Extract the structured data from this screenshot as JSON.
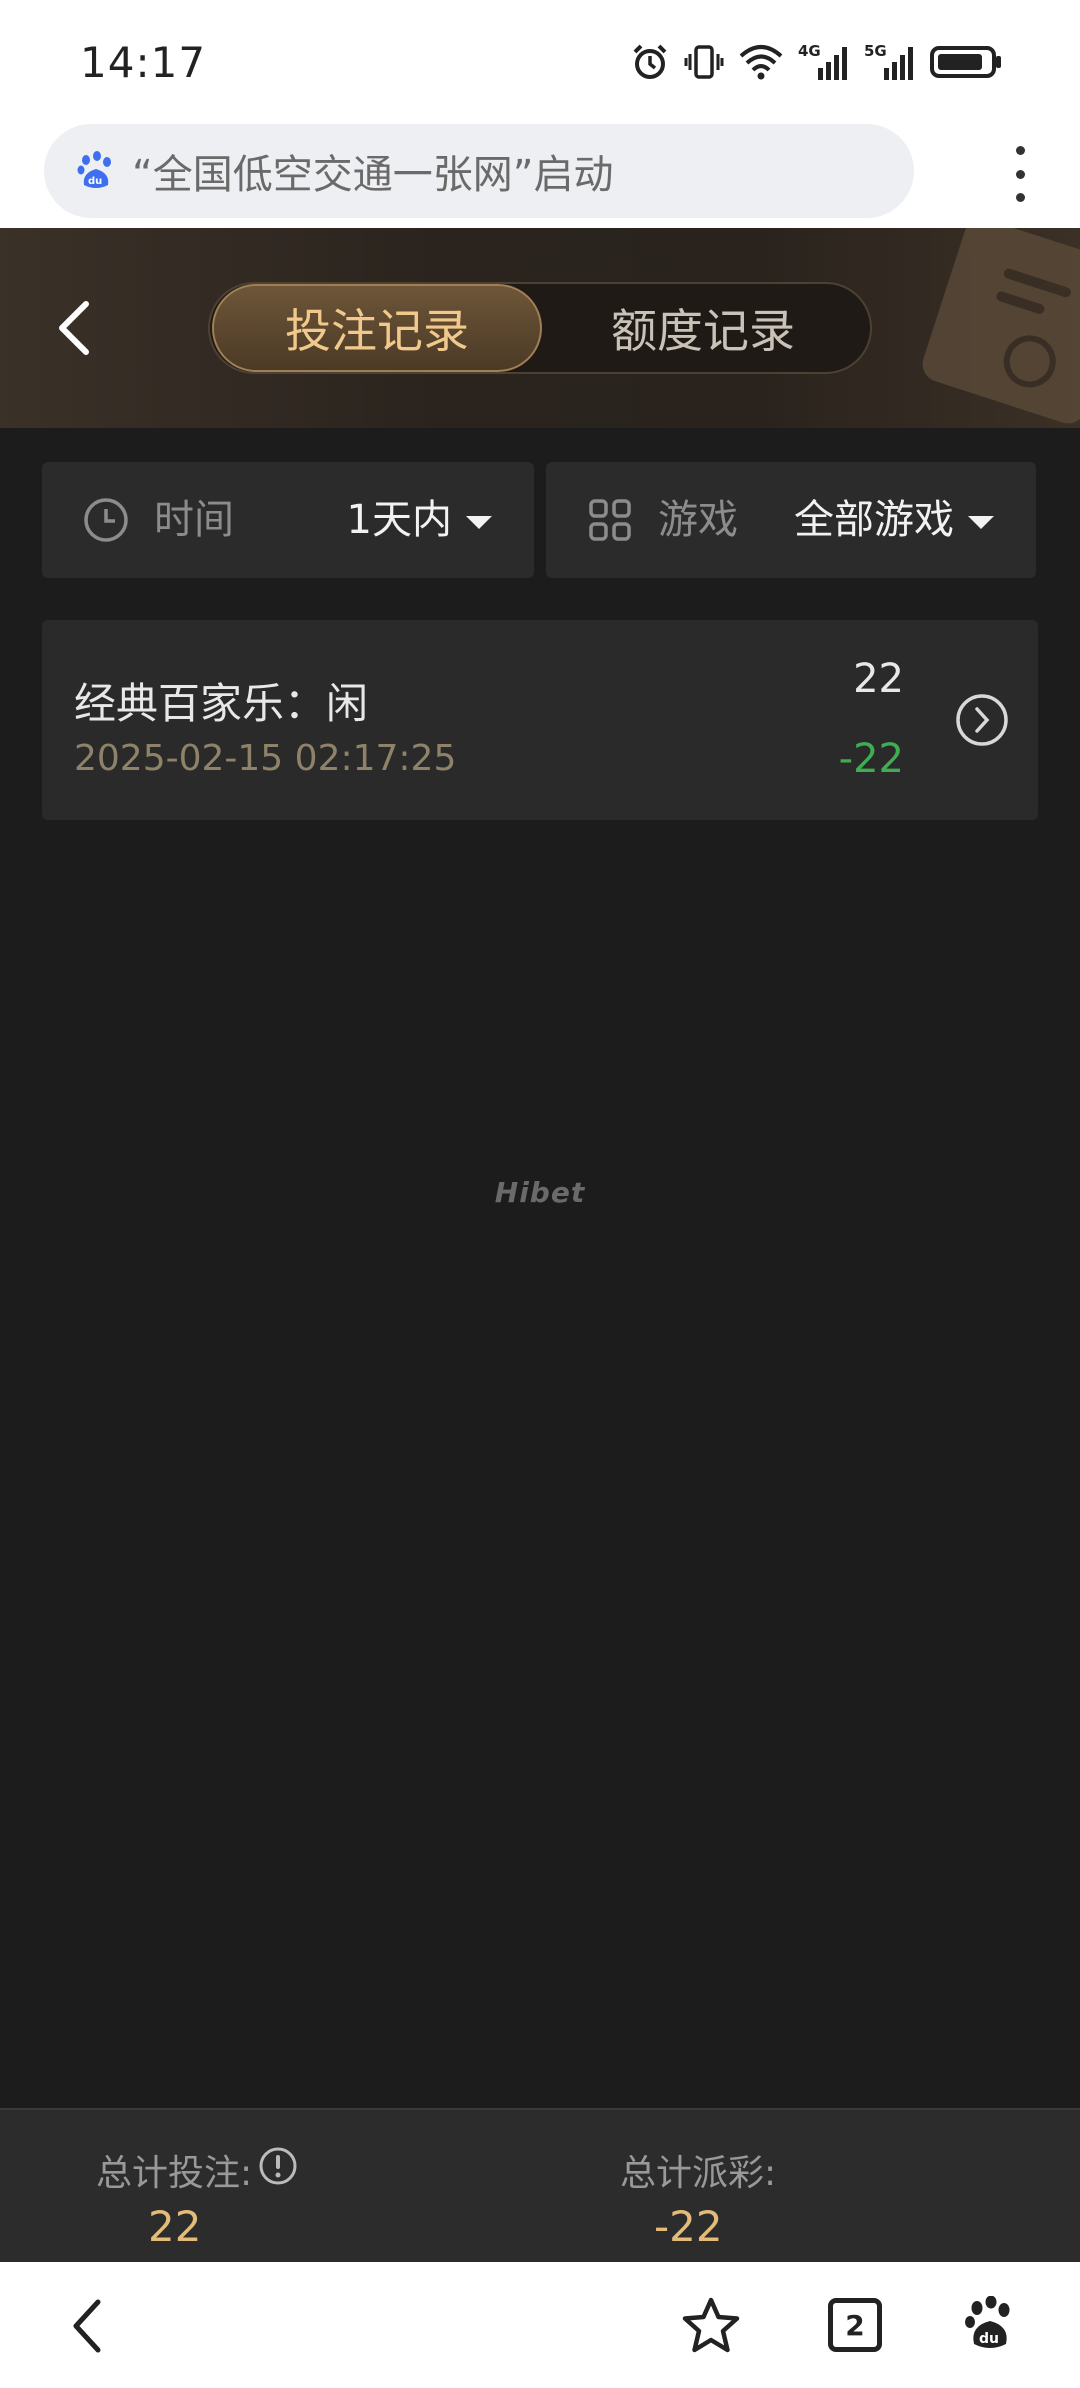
{
  "status_bar": {
    "time": "14:17",
    "network_1": "4G",
    "network_2": "5G",
    "icons": [
      "alarm-icon",
      "vibrate-icon",
      "wifi-icon",
      "signal-icon",
      "signal-icon",
      "battery-icon"
    ]
  },
  "browser": {
    "url_text": "“全国低空交通一张网”启动",
    "logo": "baidu-paw-icon",
    "menu_icon": "more-vertical-icon"
  },
  "header": {
    "tabs": [
      {
        "label": "投注记录",
        "active": true
      },
      {
        "label": "额度记录",
        "active": false
      }
    ]
  },
  "filters": {
    "time": {
      "label": "时间",
      "value": "1天内"
    },
    "game": {
      "label": "游戏",
      "value": "全部游戏"
    }
  },
  "records": [
    {
      "title": "经典百家乐：闲",
      "date": "2025-02-15 02:17:25",
      "bet": "22",
      "result": "-22"
    }
  ],
  "watermark": "Hibet",
  "totals": {
    "bet_label": "总计投注:",
    "bet_value": "22",
    "payout_label": "总计派彩:",
    "payout_value": "-22"
  },
  "bottom_nav": {
    "tabs_count": "2"
  },
  "colors": {
    "accent_gold": "#e4bb78",
    "win_green": "#3fae52",
    "background": "#1c1c1c"
  }
}
